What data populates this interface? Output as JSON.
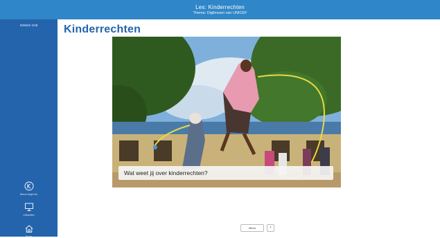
{
  "header": {
    "title": "Les: Kinderrechten",
    "subtitle": "Thema: Digilessen van UNICEF"
  },
  "sidebar": {
    "screen_counter": "Scherm 1/18",
    "items": [
      {
        "label": "Nieuw begin les",
        "icon": "k-logo-icon"
      },
      {
        "label": "Uitbreiden",
        "icon": "monitor-icon"
      },
      {
        "label": "Home",
        "icon": "home-icon"
      }
    ]
  },
  "main": {
    "heading": "Kinderrechten",
    "image_caption": "Wat weet jij over kinderrechten?",
    "menu_label": "Menu",
    "next_icon": "›"
  },
  "colors": {
    "header": "#2f86c8",
    "sidebar": "#2464ac",
    "heading": "#2464ac"
  }
}
